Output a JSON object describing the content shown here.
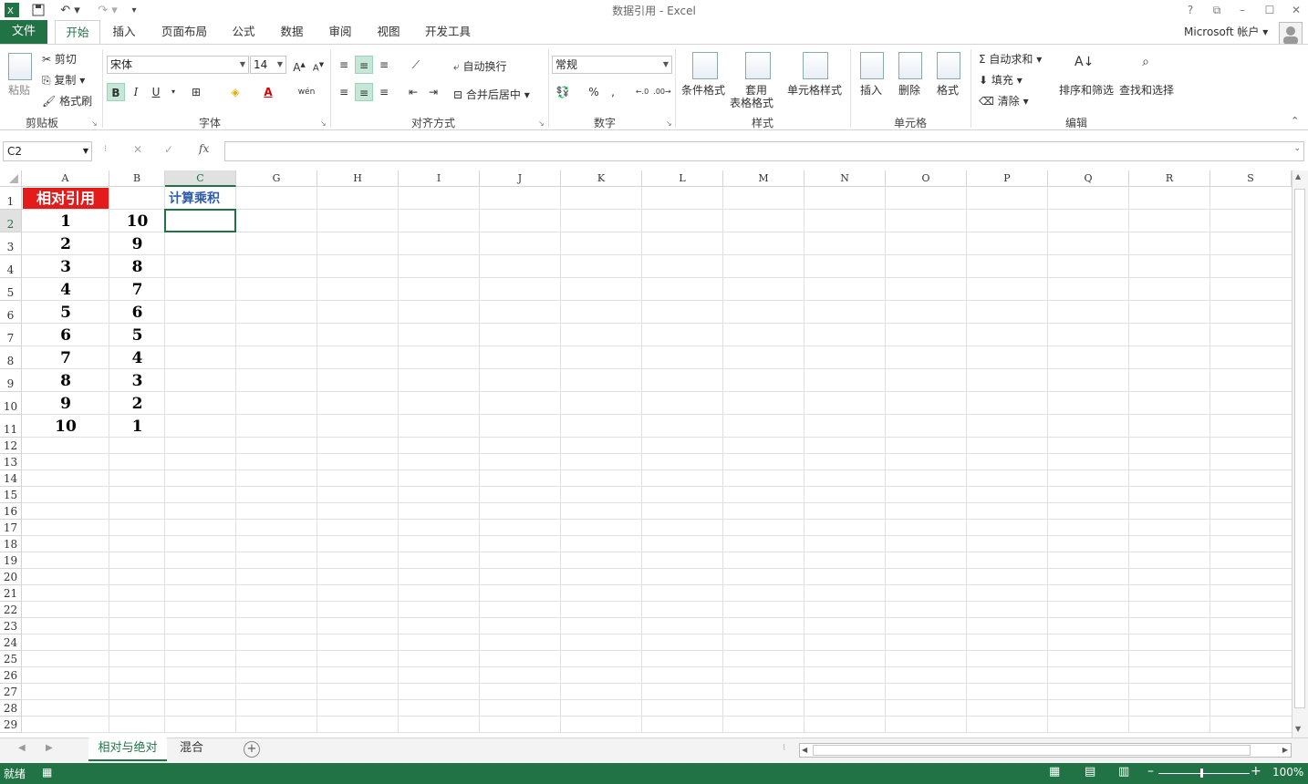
{
  "title_bar": {
    "title": "数据引用 - Excel",
    "help": "?",
    "restore": "⧉",
    "minimize": "–",
    "maximize": "☐",
    "close": "✕"
  },
  "tabs": [
    {
      "label": "文件"
    },
    {
      "label": "开始"
    },
    {
      "label": "插入"
    },
    {
      "label": "页面布局"
    },
    {
      "label": "公式"
    },
    {
      "label": "数据"
    },
    {
      "label": "审阅"
    },
    {
      "label": "视图"
    },
    {
      "label": "开发工具"
    }
  ],
  "account": {
    "label": "Microsoft 帐户"
  },
  "ribbon": {
    "clipboard": {
      "paste": "粘贴",
      "cut": "剪切",
      "copy": "复制",
      "format_painter": "格式刷",
      "group": "剪贴板"
    },
    "font": {
      "name": "宋体",
      "size": "14",
      "bold": "B",
      "italic": "I",
      "underline": "U",
      "group": "字体"
    },
    "align": {
      "wrap": "自动换行",
      "merge": "合并后居中",
      "group": "对齐方式"
    },
    "number": {
      "format": "常规",
      "percent": "%",
      "comma": ",",
      "group": "数字"
    },
    "styles": {
      "cond": "条件格式",
      "table1": "套用",
      "table2": "表格格式",
      "cell_style": "单元格样式",
      "group": "样式"
    },
    "cells": {
      "insert": "插入",
      "delete": "删除",
      "format": "格式",
      "group": "单元格"
    },
    "editing": {
      "autosum": "自动求和",
      "fill": "填充",
      "clear": "清除",
      "sort": "排序和筛选",
      "find": "查找和选择",
      "group": "编辑"
    }
  },
  "formula_bar": {
    "name_box": "C2",
    "fx": "fx",
    "cancel": "✕",
    "enter": "✓",
    "value": ""
  },
  "columns": [
    "A",
    "B",
    "C",
    "G",
    "H",
    "I",
    "J",
    "K",
    "L",
    "M",
    "N",
    "O",
    "P",
    "Q",
    "R",
    "S"
  ],
  "rows": [
    "1",
    "2",
    "3",
    "4",
    "5",
    "6",
    "7",
    "8",
    "9",
    "10",
    "11",
    "12",
    "13",
    "14",
    "15",
    "16",
    "17",
    "18",
    "19",
    "20",
    "21",
    "22",
    "23",
    "24",
    "25",
    "26",
    "27",
    "28",
    "29"
  ],
  "cells": {
    "A1": "相对引用",
    "C1": "计算乘积",
    "colA": [
      "1",
      "2",
      "3",
      "4",
      "5",
      "6",
      "7",
      "8",
      "9",
      "10"
    ],
    "colB": [
      "10",
      "9",
      "8",
      "7",
      "6",
      "5",
      "4",
      "3",
      "2",
      "1"
    ]
  },
  "sheets": [
    {
      "label": "相对与绝对"
    },
    {
      "label": "混合"
    }
  ],
  "status": {
    "ready": "就绪",
    "zoom": "100%"
  },
  "colors": {
    "excel_green": "#217346",
    "header_red": "#e31b1b",
    "link_blue": "#2e5ca8"
  }
}
